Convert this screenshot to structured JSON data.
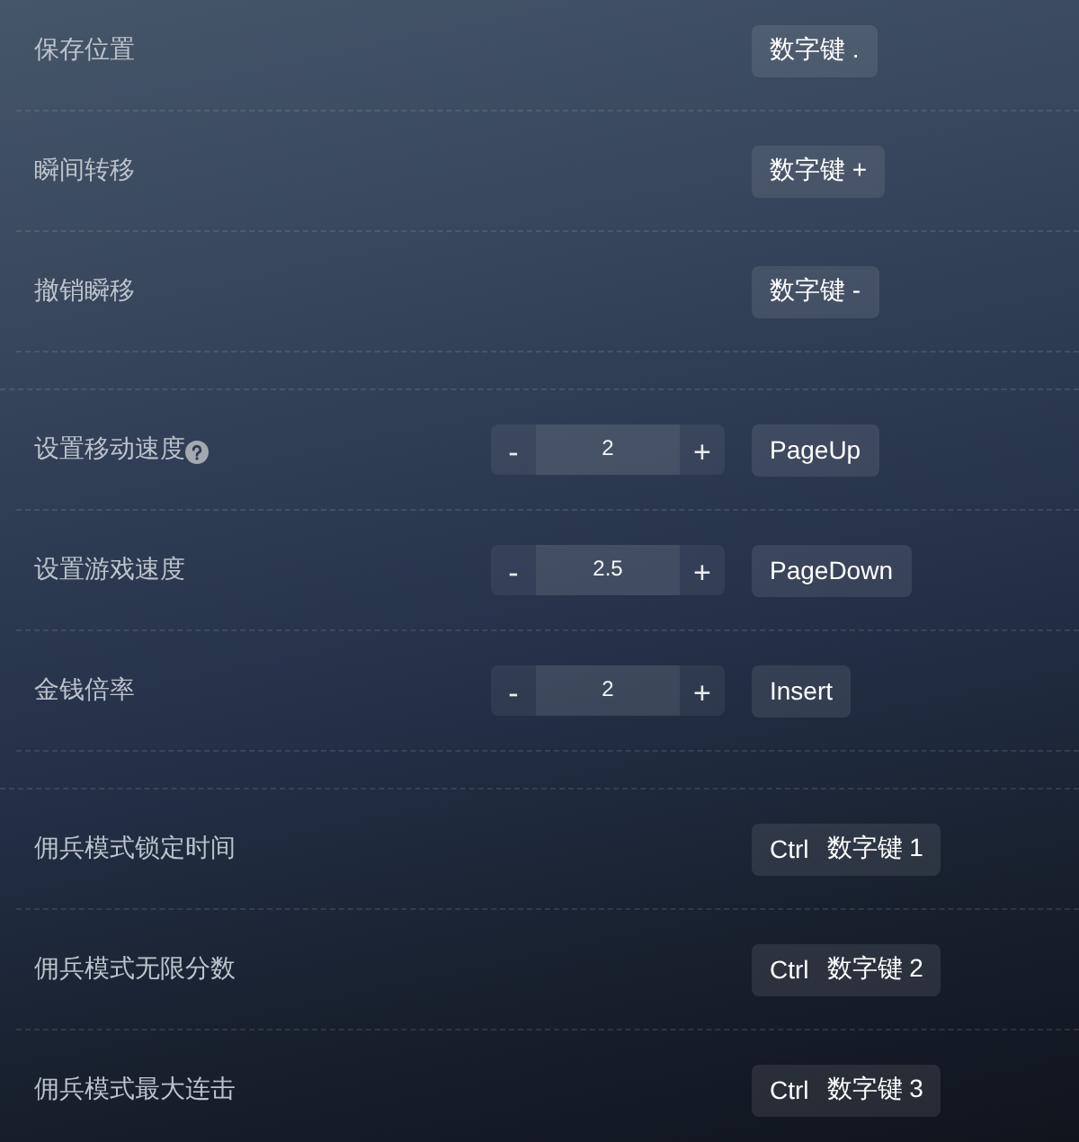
{
  "sections": [
    {
      "rows": [
        {
          "kind": "hotkey",
          "label": "保存位置",
          "keys": [
            "数字键 ."
          ]
        },
        {
          "kind": "hotkey",
          "label": "瞬间转移",
          "keys": [
            "数字键 +"
          ]
        },
        {
          "kind": "hotkey",
          "label": "撤销瞬移",
          "keys": [
            "数字键 -"
          ]
        }
      ]
    },
    {
      "rows": [
        {
          "kind": "stepper",
          "label": "设置移动速度",
          "help": true,
          "stepper": {
            "minus": "-",
            "value": "2",
            "plus": "+"
          },
          "keys": [
            "PageUp"
          ]
        },
        {
          "kind": "stepper",
          "label": "设置游戏速度",
          "stepper": {
            "minus": "-",
            "value": "2.5",
            "plus": "+"
          },
          "keys": [
            "PageDown"
          ]
        },
        {
          "kind": "stepper",
          "label": "金钱倍率",
          "stepper": {
            "minus": "-",
            "value": "2",
            "plus": "+"
          },
          "keys": [
            "Insert"
          ]
        }
      ]
    },
    {
      "rows": [
        {
          "kind": "hotkey",
          "label": "佣兵模式锁定时间",
          "keys": [
            "Ctrl",
            "数字键 1"
          ]
        },
        {
          "kind": "hotkey",
          "label": "佣兵模式无限分数",
          "keys": [
            "Ctrl",
            "数字键 2"
          ]
        },
        {
          "kind": "hotkey",
          "label": "佣兵模式最大连击",
          "keys": [
            "Ctrl",
            "数字键 3"
          ]
        }
      ]
    }
  ]
}
